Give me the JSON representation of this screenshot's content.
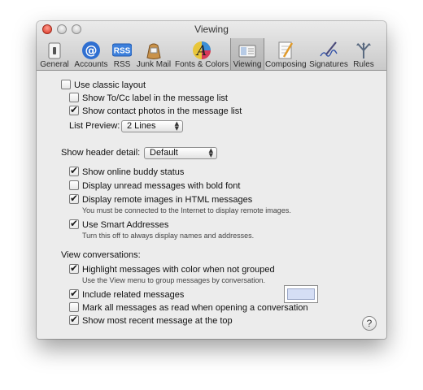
{
  "window": {
    "title": "Viewing"
  },
  "toolbar": {
    "items": [
      {
        "label": "General",
        "icon": "general-switch-icon"
      },
      {
        "label": "Accounts",
        "icon": "at-sign-icon"
      },
      {
        "label": "RSS",
        "icon": "rss-badge-icon"
      },
      {
        "label": "Junk Mail",
        "icon": "junk-mail-bag-icon"
      },
      {
        "label": "Fonts & Colors",
        "icon": "fonts-colors-icon"
      },
      {
        "label": "Viewing",
        "icon": "viewing-icon",
        "selected": true
      },
      {
        "label": "Composing",
        "icon": "composing-icon"
      },
      {
        "label": "Signatures",
        "icon": "signature-pen-icon"
      },
      {
        "label": "Rules",
        "icon": "rules-icon"
      }
    ]
  },
  "settings": {
    "classic_layout": {
      "label": "Use classic layout",
      "checked": false
    },
    "to_cc_label": {
      "label": "Show To/Cc label in the message list",
      "checked": false
    },
    "contact_photos": {
      "label": "Show contact photos in the message list",
      "checked": true
    },
    "list_preview": {
      "label": "List Preview:",
      "value": "2 Lines"
    },
    "header_detail": {
      "label": "Show header detail:",
      "value": "Default"
    },
    "buddy_status": {
      "label": "Show online buddy status",
      "checked": true
    },
    "unread_bold": {
      "label": "Display unread messages with bold font",
      "checked": false
    },
    "remote_images": {
      "label": "Display remote images in HTML messages",
      "checked": true,
      "hint": "You must be connected to the Internet to display remote images."
    },
    "smart_addresses": {
      "label": "Use Smart Addresses",
      "checked": true,
      "hint": "Turn this off to always display names and addresses."
    },
    "view_conversations": {
      "label": "View conversations:"
    },
    "highlight_color": {
      "label": "Highlight messages with color when not grouped",
      "checked": true,
      "hint": "Use the View menu to group messages by conversation.",
      "color": "#d5def5"
    },
    "related_messages": {
      "label": "Include related messages",
      "checked": true
    },
    "mark_read": {
      "label": "Mark all messages as read when opening a conversation",
      "checked": false
    },
    "recent_top": {
      "label": "Show most recent message at the top",
      "checked": true
    }
  },
  "help": {
    "label": "?"
  }
}
